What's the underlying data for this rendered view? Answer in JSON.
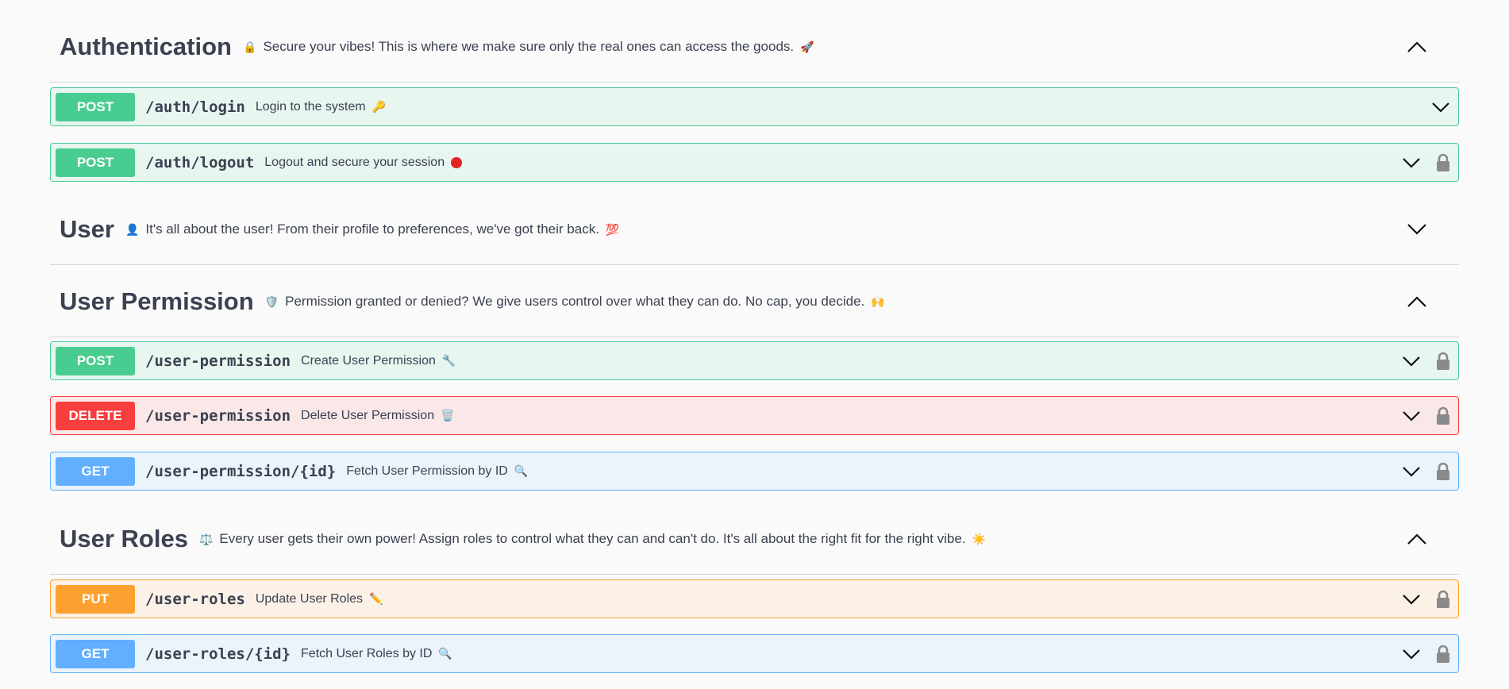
{
  "sections": [
    {
      "title": "Authentication",
      "icon": "lock-icon",
      "emoji_before": "🔒",
      "description": "Secure your vibes! This is where we make sure only the real ones can access the goods.",
      "emoji_after": "🚀",
      "expanded": true,
      "operations": [
        {
          "method": "POST",
          "path": "/auth/login",
          "summary": "Login to the system",
          "emoji": "🔑",
          "locked": false
        },
        {
          "method": "POST",
          "path": "/auth/logout",
          "summary": "Logout and secure your session",
          "emoji": "🔴",
          "locked": true
        }
      ]
    },
    {
      "title": "User",
      "emoji_before": "👤",
      "description": "It's all about the user! From their profile to preferences, we've got their back.",
      "emoji_after": "💯",
      "expanded": false,
      "operations": []
    },
    {
      "title": "User Permission",
      "emoji_before": "🛡️",
      "description": "Permission granted or denied? We give users control over what they can do. No cap, you decide.",
      "emoji_after": "🙌",
      "expanded": true,
      "operations": [
        {
          "method": "POST",
          "path": "/user-permission",
          "summary": "Create User Permission",
          "emoji": "🔧",
          "locked": true
        },
        {
          "method": "DELETE",
          "path": "/user-permission",
          "summary": "Delete User Permission",
          "emoji": "🗑️",
          "locked": true
        },
        {
          "method": "GET",
          "path": "/user-permission/{id}",
          "summary": "Fetch User Permission by ID",
          "emoji": "🔍",
          "locked": true
        }
      ]
    },
    {
      "title": "User Roles",
      "emoji_before": "⚖️",
      "description": "Every user gets their own power! Assign roles to control what they can and can't do. It's all about the right fit for the right vibe.",
      "emoji_after": "☀️",
      "expanded": true,
      "operations": [
        {
          "method": "PUT",
          "path": "/user-roles",
          "summary": "Update User Roles",
          "emoji": "✏️",
          "locked": true
        },
        {
          "method": "GET",
          "path": "/user-roles/{id}",
          "summary": "Fetch User Roles by ID",
          "emoji": "🔍",
          "locked": true
        }
      ]
    }
  ],
  "colors": {
    "post": "#49cc90",
    "delete": "#f93e3e",
    "get": "#61affe",
    "put": "#fca130",
    "text": "#3b4151"
  }
}
